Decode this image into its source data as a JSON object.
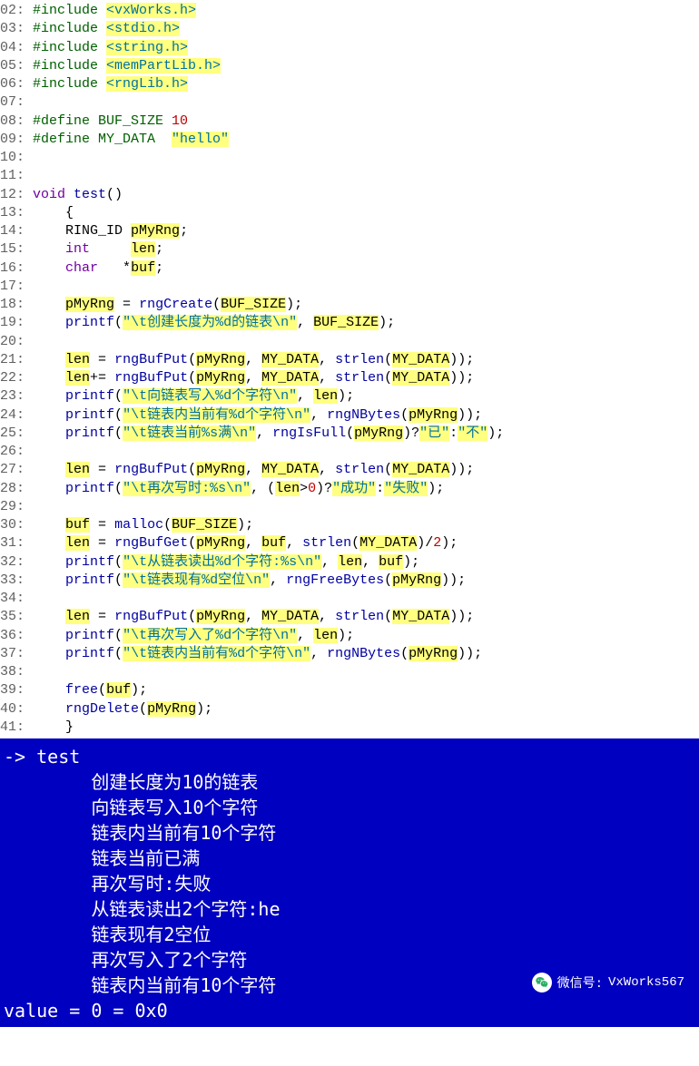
{
  "code": [
    {
      "ln": "02:",
      "tokens": [
        [
          "prep",
          " #include "
        ],
        [
          "str",
          "<vxWorks.h>"
        ]
      ]
    },
    {
      "ln": "03:",
      "tokens": [
        [
          "prep",
          " #include "
        ],
        [
          "str",
          "<stdio.h>"
        ]
      ]
    },
    {
      "ln": "04:",
      "tokens": [
        [
          "prep",
          " #include "
        ],
        [
          "str",
          "<string.h>"
        ]
      ]
    },
    {
      "ln": "05:",
      "tokens": [
        [
          "prep",
          " #include "
        ],
        [
          "str",
          "<memPartLib.h>"
        ]
      ]
    },
    {
      "ln": "06:",
      "tokens": [
        [
          "prep",
          " #include "
        ],
        [
          "str",
          "<rngLib.h>"
        ]
      ]
    },
    {
      "ln": "07:",
      "tokens": []
    },
    {
      "ln": "08:",
      "tokens": [
        [
          "prep",
          " #define BUF_SIZE "
        ],
        [
          "num",
          "10"
        ]
      ]
    },
    {
      "ln": "09:",
      "tokens": [
        [
          "prep",
          " #define MY_DATA  "
        ],
        [
          "str",
          "\"hello\""
        ]
      ]
    },
    {
      "ln": "10:",
      "tokens": []
    },
    {
      "ln": "11:",
      "tokens": []
    },
    {
      "ln": "12:",
      "tokens": [
        [
          "kw",
          " void "
        ],
        [
          "fn",
          "test"
        ],
        [
          "pun",
          "()"
        ]
      ]
    },
    {
      "ln": "13:",
      "tokens": [
        [
          "pun",
          "     {"
        ]
      ]
    },
    {
      "ln": "14:",
      "tokens": [
        [
          "id",
          "     RING_ID "
        ],
        [
          "hl",
          "pMyRng"
        ],
        [
          "pun",
          ";"
        ]
      ]
    },
    {
      "ln": "15:",
      "tokens": [
        [
          "kw",
          "     int     "
        ],
        [
          "hl",
          "len"
        ],
        [
          "pun",
          ";"
        ]
      ]
    },
    {
      "ln": "16:",
      "tokens": [
        [
          "kw",
          "     char   "
        ],
        [
          "pun",
          "*"
        ],
        [
          "hl",
          "buf"
        ],
        [
          "pun",
          ";"
        ]
      ]
    },
    {
      "ln": "17:",
      "tokens": []
    },
    {
      "ln": "18:",
      "tokens": [
        [
          "id",
          "     "
        ],
        [
          "hl",
          "pMyRng"
        ],
        [
          "id",
          " = "
        ],
        [
          "fn",
          "rngCreate"
        ],
        [
          "pun",
          "("
        ],
        [
          "hl",
          "BUF_SIZE"
        ],
        [
          "pun",
          ");"
        ]
      ]
    },
    {
      "ln": "19:",
      "tokens": [
        [
          "id",
          "     "
        ],
        [
          "fn",
          "printf"
        ],
        [
          "pun",
          "("
        ],
        [
          "str",
          "\"\\t创建长度为%d的链表\\n\""
        ],
        [
          "pun",
          ", "
        ],
        [
          "hl",
          "BUF_SIZE"
        ],
        [
          "pun",
          ");"
        ]
      ]
    },
    {
      "ln": "20:",
      "tokens": []
    },
    {
      "ln": "21:",
      "tokens": [
        [
          "id",
          "     "
        ],
        [
          "hl",
          "len"
        ],
        [
          "id",
          " = "
        ],
        [
          "fn",
          "rngBufPut"
        ],
        [
          "pun",
          "("
        ],
        [
          "hl",
          "pMyRng"
        ],
        [
          "pun",
          ", "
        ],
        [
          "hl",
          "MY_DATA"
        ],
        [
          "pun",
          ", "
        ],
        [
          "fn",
          "strlen"
        ],
        [
          "pun",
          "("
        ],
        [
          "hl",
          "MY_DATA"
        ],
        [
          "pun",
          "));"
        ]
      ]
    },
    {
      "ln": "22:",
      "tokens": [
        [
          "id",
          "     "
        ],
        [
          "hl",
          "len"
        ],
        [
          "id",
          "+= "
        ],
        [
          "fn",
          "rngBufPut"
        ],
        [
          "pun",
          "("
        ],
        [
          "hl",
          "pMyRng"
        ],
        [
          "pun",
          ", "
        ],
        [
          "hl",
          "MY_DATA"
        ],
        [
          "pun",
          ", "
        ],
        [
          "fn",
          "strlen"
        ],
        [
          "pun",
          "("
        ],
        [
          "hl",
          "MY_DATA"
        ],
        [
          "pun",
          "));"
        ]
      ]
    },
    {
      "ln": "23:",
      "tokens": [
        [
          "id",
          "     "
        ],
        [
          "fn",
          "printf"
        ],
        [
          "pun",
          "("
        ],
        [
          "str",
          "\"\\t向链表写入%d个字符\\n\""
        ],
        [
          "pun",
          ", "
        ],
        [
          "hl",
          "len"
        ],
        [
          "pun",
          ");"
        ]
      ]
    },
    {
      "ln": "24:",
      "tokens": [
        [
          "id",
          "     "
        ],
        [
          "fn",
          "printf"
        ],
        [
          "pun",
          "("
        ],
        [
          "str",
          "\"\\t链表内当前有%d个字符\\n\""
        ],
        [
          "pun",
          ", "
        ],
        [
          "fn",
          "rngNBytes"
        ],
        [
          "pun",
          "("
        ],
        [
          "hl",
          "pMyRng"
        ],
        [
          "pun",
          "));"
        ]
      ]
    },
    {
      "ln": "25:",
      "tokens": [
        [
          "id",
          "     "
        ],
        [
          "fn",
          "printf"
        ],
        [
          "pun",
          "("
        ],
        [
          "str",
          "\"\\t链表当前%s满\\n\""
        ],
        [
          "pun",
          ", "
        ],
        [
          "fn",
          "rngIsFull"
        ],
        [
          "pun",
          "("
        ],
        [
          "hl",
          "pMyRng"
        ],
        [
          "pun",
          ")?"
        ],
        [
          "str",
          "\"已\""
        ],
        [
          "pun",
          ":"
        ],
        [
          "str",
          "\"不\""
        ],
        [
          "pun",
          ");"
        ]
      ]
    },
    {
      "ln": "26:",
      "tokens": []
    },
    {
      "ln": "27:",
      "tokens": [
        [
          "id",
          "     "
        ],
        [
          "hl",
          "len"
        ],
        [
          "id",
          " = "
        ],
        [
          "fn",
          "rngBufPut"
        ],
        [
          "pun",
          "("
        ],
        [
          "hl",
          "pMyRng"
        ],
        [
          "pun",
          ", "
        ],
        [
          "hl",
          "MY_DATA"
        ],
        [
          "pun",
          ", "
        ],
        [
          "fn",
          "strlen"
        ],
        [
          "pun",
          "("
        ],
        [
          "hl",
          "MY_DATA"
        ],
        [
          "pun",
          "));"
        ]
      ]
    },
    {
      "ln": "28:",
      "tokens": [
        [
          "id",
          "     "
        ],
        [
          "fn",
          "printf"
        ],
        [
          "pun",
          "("
        ],
        [
          "str",
          "\"\\t再次写时:%s\\n\""
        ],
        [
          "pun",
          ", ("
        ],
        [
          "hl",
          "len"
        ],
        [
          "pun",
          ">"
        ],
        [
          "num",
          "0"
        ],
        [
          "pun",
          ")?"
        ],
        [
          "str",
          "\"成功\""
        ],
        [
          "pun",
          ":"
        ],
        [
          "str",
          "\"失败\""
        ],
        [
          "pun",
          ");"
        ]
      ]
    },
    {
      "ln": "29:",
      "tokens": []
    },
    {
      "ln": "30:",
      "tokens": [
        [
          "id",
          "     "
        ],
        [
          "hl",
          "buf"
        ],
        [
          "id",
          " = "
        ],
        [
          "fn",
          "malloc"
        ],
        [
          "pun",
          "("
        ],
        [
          "hl",
          "BUF_SIZE"
        ],
        [
          "pun",
          ");"
        ]
      ]
    },
    {
      "ln": "31:",
      "tokens": [
        [
          "id",
          "     "
        ],
        [
          "hl",
          "len"
        ],
        [
          "id",
          " = "
        ],
        [
          "fn",
          "rngBufGet"
        ],
        [
          "pun",
          "("
        ],
        [
          "hl",
          "pMyRng"
        ],
        [
          "pun",
          ", "
        ],
        [
          "hl",
          "buf"
        ],
        [
          "pun",
          ", "
        ],
        [
          "fn",
          "strlen"
        ],
        [
          "pun",
          "("
        ],
        [
          "hl",
          "MY_DATA"
        ],
        [
          "pun",
          ")/"
        ],
        [
          "num",
          "2"
        ],
        [
          "pun",
          ");"
        ]
      ]
    },
    {
      "ln": "32:",
      "tokens": [
        [
          "id",
          "     "
        ],
        [
          "fn",
          "printf"
        ],
        [
          "pun",
          "("
        ],
        [
          "str",
          "\"\\t从链表读出%d个字符:%s\\n\""
        ],
        [
          "pun",
          ", "
        ],
        [
          "hl",
          "len"
        ],
        [
          "pun",
          ", "
        ],
        [
          "hl",
          "buf"
        ],
        [
          "pun",
          ");"
        ]
      ]
    },
    {
      "ln": "33:",
      "tokens": [
        [
          "id",
          "     "
        ],
        [
          "fn",
          "printf"
        ],
        [
          "pun",
          "("
        ],
        [
          "str",
          "\"\\t链表现有%d空位\\n\""
        ],
        [
          "pun",
          ", "
        ],
        [
          "fn",
          "rngFreeBytes"
        ],
        [
          "pun",
          "("
        ],
        [
          "hl",
          "pMyRng"
        ],
        [
          "pun",
          "));"
        ]
      ]
    },
    {
      "ln": "34:",
      "tokens": []
    },
    {
      "ln": "35:",
      "tokens": [
        [
          "id",
          "     "
        ],
        [
          "hl",
          "len"
        ],
        [
          "id",
          " = "
        ],
        [
          "fn",
          "rngBufPut"
        ],
        [
          "pun",
          "("
        ],
        [
          "hl",
          "pMyRng"
        ],
        [
          "pun",
          ", "
        ],
        [
          "hl",
          "MY_DATA"
        ],
        [
          "pun",
          ", "
        ],
        [
          "fn",
          "strlen"
        ],
        [
          "pun",
          "("
        ],
        [
          "hl",
          "MY_DATA"
        ],
        [
          "pun",
          "));"
        ]
      ]
    },
    {
      "ln": "36:",
      "tokens": [
        [
          "id",
          "     "
        ],
        [
          "fn",
          "printf"
        ],
        [
          "pun",
          "("
        ],
        [
          "str",
          "\"\\t再次写入了%d个字符\\n\""
        ],
        [
          "pun",
          ", "
        ],
        [
          "hl",
          "len"
        ],
        [
          "pun",
          ");"
        ]
      ]
    },
    {
      "ln": "37:",
      "tokens": [
        [
          "id",
          "     "
        ],
        [
          "fn",
          "printf"
        ],
        [
          "pun",
          "("
        ],
        [
          "str",
          "\"\\t链表内当前有%d个字符\\n\""
        ],
        [
          "pun",
          ", "
        ],
        [
          "fn",
          "rngNBytes"
        ],
        [
          "pun",
          "("
        ],
        [
          "hl",
          "pMyRng"
        ],
        [
          "pun",
          "));"
        ]
      ]
    },
    {
      "ln": "38:",
      "tokens": []
    },
    {
      "ln": "39:",
      "tokens": [
        [
          "id",
          "     "
        ],
        [
          "fn",
          "free"
        ],
        [
          "pun",
          "("
        ],
        [
          "hl",
          "buf"
        ],
        [
          "pun",
          ");"
        ]
      ]
    },
    {
      "ln": "40:",
      "tokens": [
        [
          "id",
          "     "
        ],
        [
          "fn",
          "rngDelete"
        ],
        [
          "pun",
          "("
        ],
        [
          "hl",
          "pMyRng"
        ],
        [
          "pun",
          ");"
        ]
      ]
    },
    {
      "ln": "41:",
      "tokens": [
        [
          "pun",
          "     }"
        ]
      ]
    }
  ],
  "terminal": [
    "-> test",
    "        创建长度为10的链表",
    "        向链表写入10个字符",
    "        链表内当前有10个字符",
    "        链表当前已满",
    "        再次写时:失败",
    "        从链表读出2个字符:he",
    "        链表现有2空位",
    "        再次写入了2个字符",
    "        链表内当前有10个字符",
    "value = 0 = 0x0"
  ],
  "watermark": {
    "label": "微信号:",
    "id": "VxWorks567"
  }
}
